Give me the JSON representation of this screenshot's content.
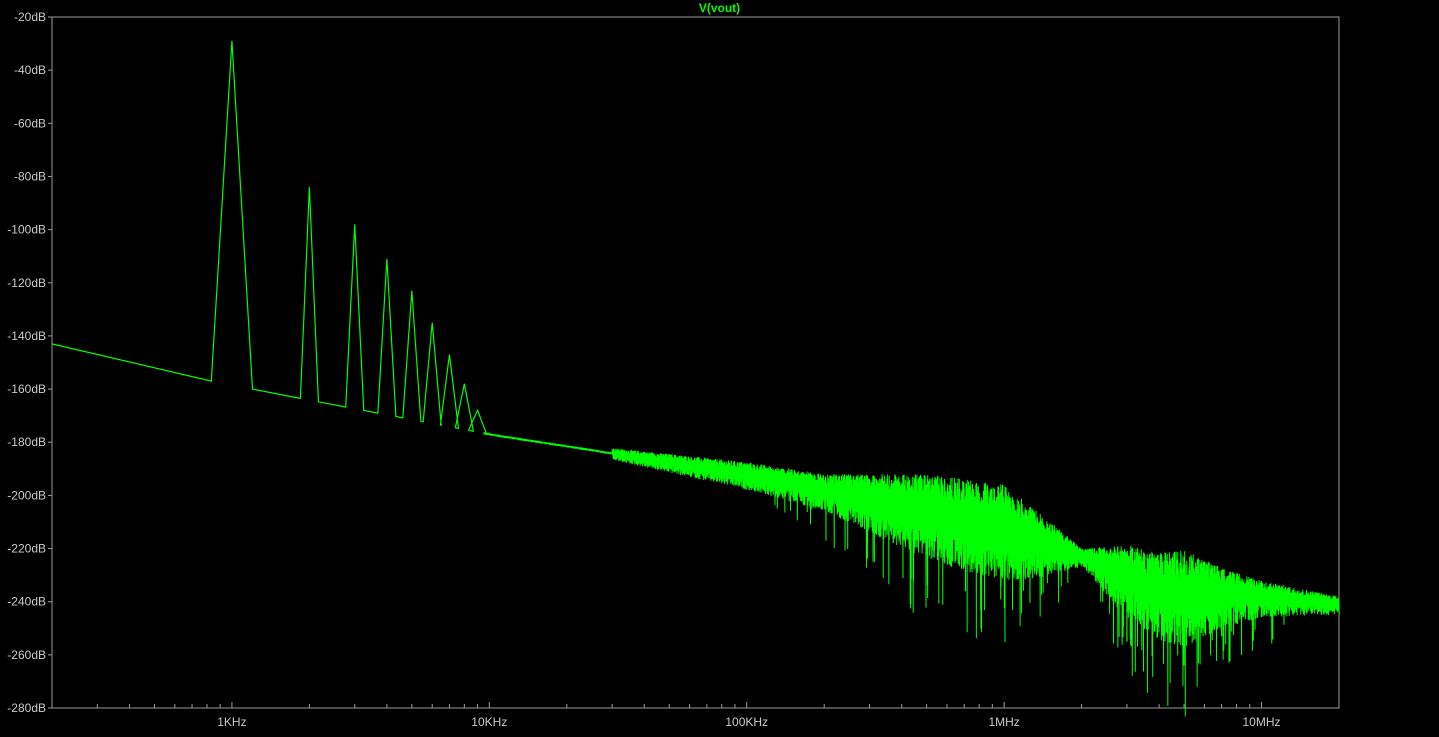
{
  "title": "V(vout)",
  "colors": {
    "background": "#000000",
    "trace": "#00ff00",
    "axis": "#9a9a9a",
    "tick_label": "#c8c8c8"
  },
  "chart_data": {
    "type": "line",
    "title": "V(vout)",
    "xlabel": "",
    "ylabel": "",
    "x_scale": "log",
    "xlim": [
      200,
      20000000
    ],
    "ylim": [
      -280,
      -20
    ],
    "grid": false,
    "yticks": [
      {
        "value": -20,
        "label": "-20dB"
      },
      {
        "value": -40,
        "label": "-40dB"
      },
      {
        "value": -60,
        "label": "-60dB"
      },
      {
        "value": -80,
        "label": "-80dB"
      },
      {
        "value": -100,
        "label": "-100dB"
      },
      {
        "value": -120,
        "label": "-120dB"
      },
      {
        "value": -140,
        "label": "-140dB"
      },
      {
        "value": -160,
        "label": "-160dB"
      },
      {
        "value": -180,
        "label": "-180dB"
      },
      {
        "value": -200,
        "label": "-200dB"
      },
      {
        "value": -220,
        "label": "-220dB"
      },
      {
        "value": -240,
        "label": "-240dB"
      },
      {
        "value": -260,
        "label": "-260dB"
      },
      {
        "value": -280,
        "label": "-280dB"
      }
    ],
    "xticks": [
      {
        "value": 1000,
        "label": "1KHz"
      },
      {
        "value": 10000,
        "label": "10KHz"
      },
      {
        "value": 100000,
        "label": "100KHz"
      },
      {
        "value": 1000000,
        "label": "1MHz"
      },
      {
        "value": 10000000,
        "label": "10MHz"
      }
    ],
    "series": [
      {
        "name": "V(vout)",
        "noise_floor": [
          [
            200,
            -143
          ],
          [
            830,
            -157
          ],
          [
            1190,
            -160
          ],
          [
            10000,
            -177
          ],
          [
            100000,
            -192
          ],
          [
            1000000,
            -212
          ],
          [
            2000000,
            -223
          ],
          [
            4000000,
            -236
          ],
          [
            10000000,
            -238
          ],
          [
            20000000,
            -241
          ]
        ],
        "harmonics": [
          {
            "f": 1000,
            "db": -29
          },
          {
            "f": 2000,
            "db": -84
          },
          {
            "f": 3000,
            "db": -98
          },
          {
            "f": 4000,
            "db": -111
          },
          {
            "f": 5000,
            "db": -123
          },
          {
            "f": 6000,
            "db": -135
          },
          {
            "f": 7000,
            "db": -147
          },
          {
            "f": 8000,
            "db": -158
          },
          {
            "f": 9000,
            "db": -168
          }
        ],
        "noise_band": [
          [
            30000,
            2
          ],
          [
            200000,
            6
          ],
          [
            500000,
            14
          ],
          [
            1000000,
            16
          ],
          [
            1500000,
            9
          ],
          [
            2000000,
            3
          ],
          [
            3000000,
            12
          ],
          [
            5000000,
            16
          ],
          [
            7000000,
            10
          ],
          [
            10000000,
            6
          ],
          [
            20000000,
            3
          ]
        ],
        "notches": [
          {
            "f": 3000000,
            "db": -255
          },
          {
            "f": 5000000,
            "db": -264
          },
          {
            "f": 7000000,
            "db": -253
          },
          {
            "f": 9000000,
            "db": -247
          },
          {
            "f": 11000000,
            "db": -244
          }
        ]
      }
    ]
  }
}
